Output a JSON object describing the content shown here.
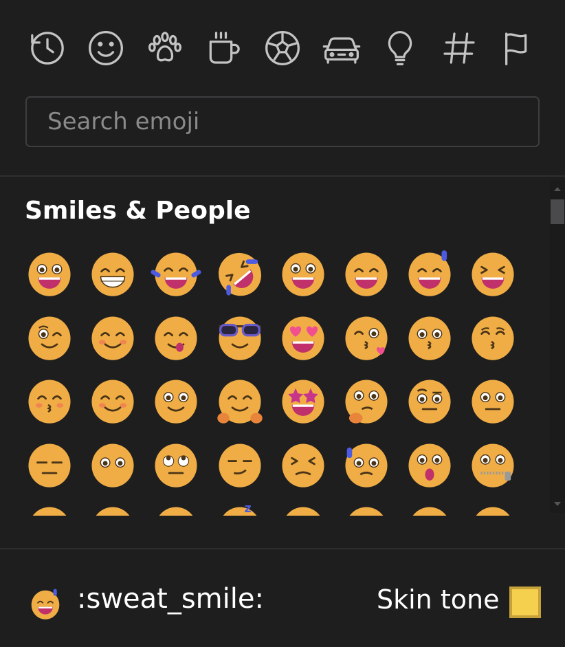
{
  "categories": [
    {
      "name": "recent-icon"
    },
    {
      "name": "smiley-icon"
    },
    {
      "name": "paw-icon"
    },
    {
      "name": "coffee-cup-icon"
    },
    {
      "name": "soccer-ball-icon"
    },
    {
      "name": "car-icon"
    },
    {
      "name": "lightbulb-icon"
    },
    {
      "name": "hashtag-icon"
    },
    {
      "name": "flag-icon"
    }
  ],
  "search": {
    "placeholder": "Search emoji",
    "value": ""
  },
  "section": {
    "title": "Smiles & People"
  },
  "emojis": [
    "grinning",
    "smiley",
    "joy",
    "rofl",
    "grin",
    "smile",
    "sweat_smile",
    "laughing",
    "wink",
    "blush",
    "yum",
    "sunglasses",
    "heart_eyes",
    "kissing_heart",
    "kissing",
    "kissing_closed_eyes",
    "kissing_smiling_eyes",
    "relaxed",
    "slightly_smiling_face",
    "hugging",
    "star_struck",
    "thinking",
    "face_with_raised_eyebrow",
    "neutral_face",
    "expressionless",
    "no_mouth",
    "rolling_eyes",
    "smirk",
    "persevere",
    "disappointed_relieved",
    "open_mouth",
    "zipper_mouth",
    "hushed",
    "sleepy",
    "tired_face",
    "sleeping",
    "relieved",
    "stuck_out_tongue",
    "stuck_out_tongue_winking_eye",
    "drooling"
  ],
  "preview": {
    "name": ":sweat_smile:",
    "emoji": "sweat_smile"
  },
  "skin_tone": {
    "label": "Skin tone",
    "color": "#f5cf4e"
  },
  "colors": {
    "background": "#1e1e1f",
    "face": "#f0ad45",
    "accent": "#4c5be0"
  }
}
